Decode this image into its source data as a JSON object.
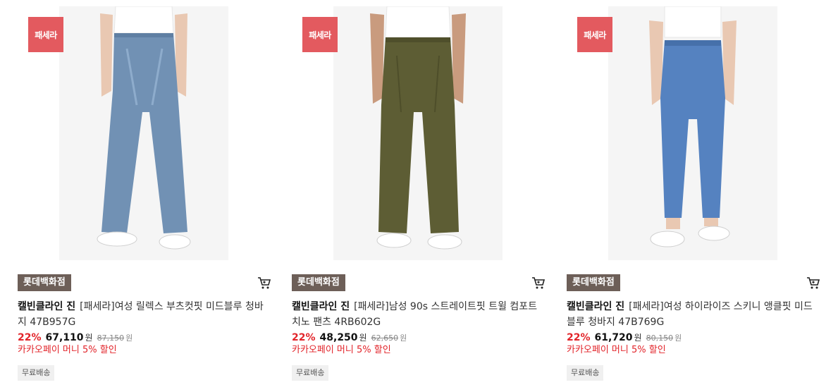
{
  "products": [
    {
      "promo_logo": "패세라",
      "store": "롯데백화점",
      "brand": "캘빈클라인 진",
      "name": "[패세라]여성 릴렉스 부츠컷핏 미드블루 청바지 47B957G",
      "discount": "22%",
      "price": "67,110",
      "price_unit": "원",
      "original_price": "87,150",
      "original_unit": "원",
      "pay_benefit": "카카오페이 머니 5% 할인",
      "shipping": "무료배송",
      "pants_color": "#7191b4",
      "pants_style": "bootcut"
    },
    {
      "promo_logo": "패세라",
      "store": "롯데백화점",
      "brand": "캘빈클라인 진",
      "name": "[패세라]남성 90s 스트레이트핏 트윌 컴포트 치노 팬츠 4RB602G",
      "discount": "22%",
      "price": "48,250",
      "price_unit": "원",
      "original_price": "62,650",
      "original_unit": "원",
      "pay_benefit": "카카오페이 머니 5% 할인",
      "shipping": "무료배송",
      "pants_color": "#5d5d34",
      "pants_style": "straight"
    },
    {
      "promo_logo": "패세라",
      "store": "롯데백화점",
      "brand": "캘빈클라인 진",
      "name": "[패세라]여성 하이라이즈 스키니 앵클핏 미드블루 청바지 47B769G",
      "discount": "22%",
      "price": "61,720",
      "price_unit": "원",
      "original_price": "80,150",
      "original_unit": "원",
      "pay_benefit": "카카오페이 머니 5% 할인",
      "shipping": "무료배송",
      "pants_color": "#5582c0",
      "pants_style": "skinny"
    }
  ],
  "icons": {
    "cart": "cart-icon"
  }
}
